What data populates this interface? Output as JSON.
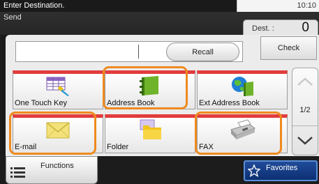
{
  "header": {
    "title": "Enter Destination.",
    "time": "10:10",
    "mode": "Send"
  },
  "destination": {
    "label": "Dest. :",
    "count": "0",
    "check_label": "Check",
    "input_value": "",
    "recall_label": "Recall"
  },
  "tiles": [
    {
      "label": "One Touch Key",
      "icon": "one-touch-key-icon"
    },
    {
      "label": "Address Book",
      "icon": "address-book-icon"
    },
    {
      "label": "Ext Address Book",
      "icon": "ext-address-book-icon"
    },
    {
      "label": "E-mail",
      "icon": "email-icon"
    },
    {
      "label": "Folder",
      "icon": "folder-icon"
    },
    {
      "label": "FAX",
      "icon": "fax-icon"
    }
  ],
  "paging": {
    "indicator": "1/2"
  },
  "bottom": {
    "functions_label": "Functions",
    "favorites_label": "Favorites"
  },
  "colors": {
    "highlight": "#ef8a1e",
    "tile_stripe": "#e23c3c",
    "favorites_bg": "#163d85"
  }
}
